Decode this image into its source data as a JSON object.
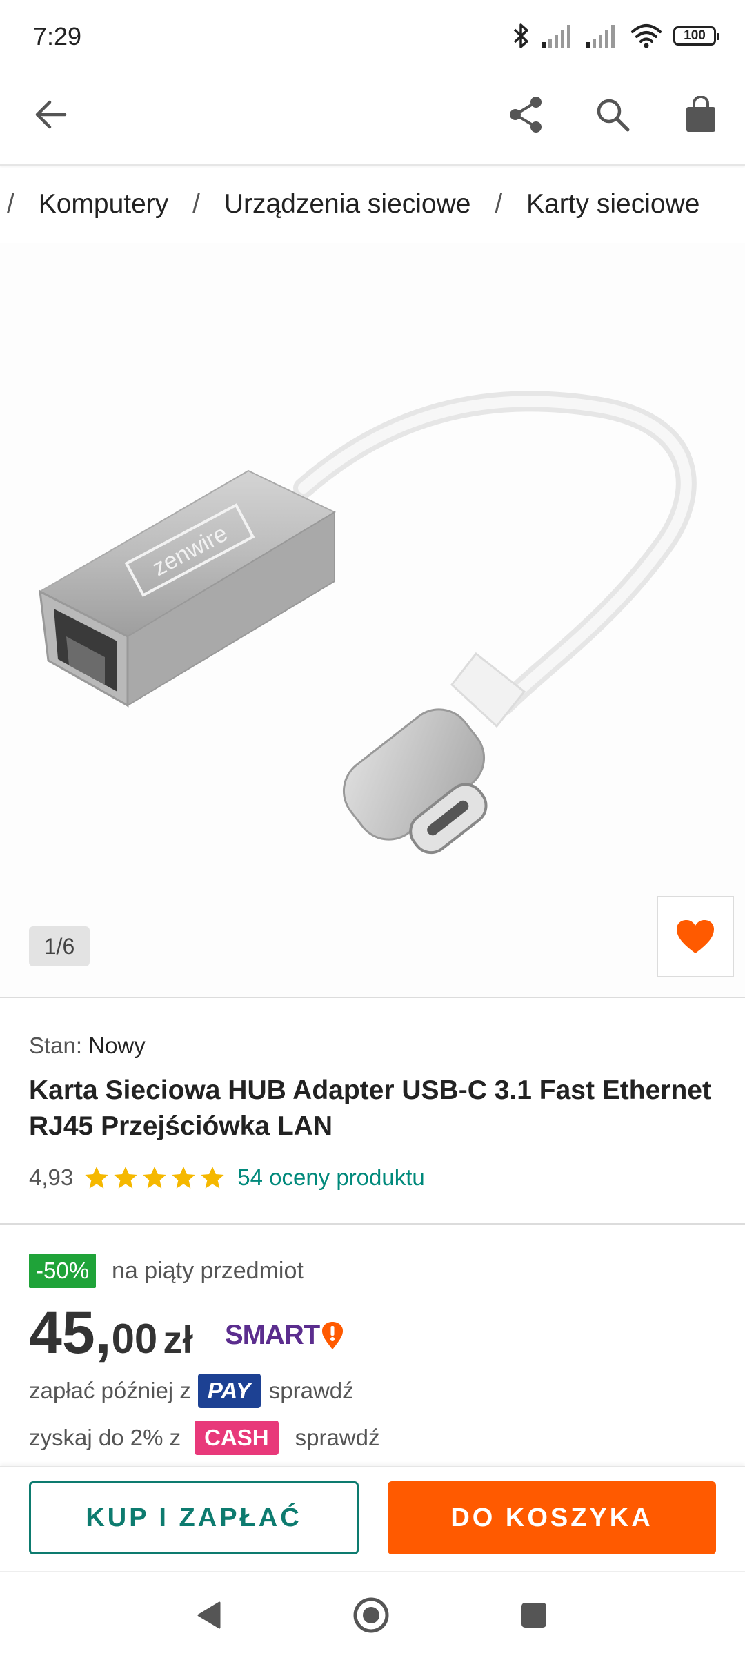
{
  "status_bar": {
    "time": "7:29",
    "battery": "100"
  },
  "breadcrumb": [
    {
      "label": "Komputery"
    },
    {
      "label": "Urządzenia sieciowe"
    },
    {
      "label": "Karty sieciowe"
    }
  ],
  "gallery": {
    "counter": "1/6",
    "brand_print": "zenwire"
  },
  "product": {
    "condition_label": "Stan:",
    "condition_value": "Nowy",
    "title": "Karta Sieciowa HUB Adapter USB-C 3.1 Fast Ethernet RJ45 Przejściówka LAN",
    "rating_value": "4,93",
    "rating_stars": 5,
    "rating_link": "54 oceny produktu"
  },
  "pricing": {
    "discount_badge": "-50%",
    "discount_text": "na piąty przedmiot",
    "price_integer": "45,",
    "price_decimal": "00",
    "currency": "zł",
    "smart_label": "SMART",
    "pay_later_text": "zapłać później z",
    "pay_badge": "PAY",
    "pay_check": "sprawdź",
    "cashback_text": "zyskaj do 2% z",
    "cash_badge": "CASH",
    "cash_check": "sprawdź"
  },
  "actions": {
    "buy_now": "KUP I ZAPŁAĆ",
    "add_to_cart": "DO KOSZYKA"
  },
  "colors": {
    "accent_orange": "#ff5a00",
    "teal": "#0d7b6f",
    "rating_link": "#00897b",
    "star": "#f5b800",
    "discount_green": "#1fa339",
    "pay_blue": "#1d4193",
    "cash_pink": "#e8397a",
    "smart_purple": "#5b2d8e"
  }
}
